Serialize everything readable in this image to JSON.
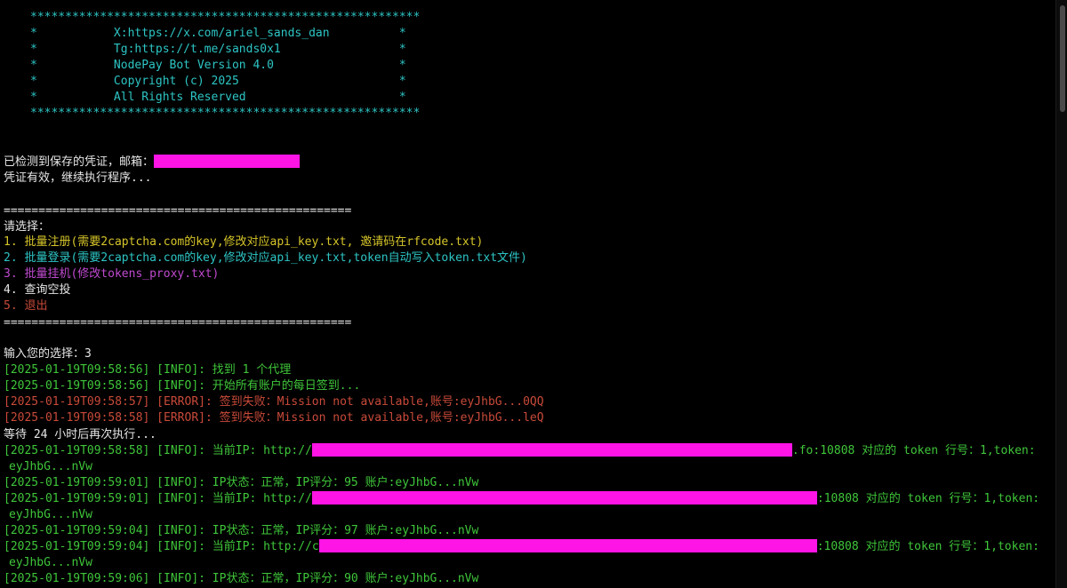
{
  "banner": {
    "border": "********************************************************",
    "lines": [
      "*           X:https://x.com/ariel_sands_dan          *",
      "*           Tg:https://t.me/sands0x1                 *",
      "*           NodePay Bot Version 4.0                  *",
      "*           Copyright (c) 2025                       *",
      "*           All Rights Reserved                      *"
    ]
  },
  "credentials": {
    "detected": "已检测到保存的凭证，邮箱：",
    "valid": "凭证有效，继续执行程序..."
  },
  "menu": {
    "divider": "==================================================",
    "prompt": "请选择：",
    "options": [
      "1. 批量注册(需要2captcha.com的key,修改对应api_key.txt, 邀请码在rfcode.txt)",
      "2. 批量登录(需要2captcha.com的key,修改对应api_key.txt,token自动写入token.txt文件)",
      "3. 批量挂机(修改tokens_proxy.txt)",
      "4. 查询空投",
      "5. 退出"
    ]
  },
  "input_prompt": "输入您的选择：3",
  "log": {
    "l1": "[2025-01-19T09:58:56] [INFO]: 找到 1 个代理",
    "l2": "[2025-01-19T09:58:56] [INFO]: 开始所有账户的每日签到...",
    "l3": "[2025-01-19T09:58:57] [ERROR]: 签到失败：Mission not available,账号:eyJhbG...0QQ",
    "l4": "[2025-01-19T09:58:58] [ERROR]: 签到失败：Mission not available,账号:eyJhbG...leQ",
    "wait": "等待 24 小时后再次执行...",
    "ip1_prefix": "[2025-01-19T09:58:58] [INFO]: 当前IP: http://",
    "ip1_suffix": ".fo:10808 对应的 token 行号：1,token:",
    "ip1_token": "eyJhbG...nVw",
    "status1": "[2025-01-19T09:59:01] [INFO]: IP状态：正常，IP评分：95 账户:eyJhbG...nVw",
    "ip2_prefix": "[2025-01-19T09:59:01] [INFO]: 当前IP: http://",
    "ip2_suffix": ":10808 对应的 token 行号：1,token:",
    "ip2_token": "eyJhbG...nVw",
    "status2": "[2025-01-19T09:59:04] [INFO]: IP状态：正常，IP评分：97 账户:eyJhbG...nVw",
    "ip3_prefix": "[2025-01-19T09:59:04] [INFO]: 当前IP: http://c",
    "ip3_suffix": ":10808 对应的 token 行号：1,token:",
    "ip3_token": "eyJhbG...nVw",
    "status3": "[2025-01-19T09:59:06] [INFO]: IP状态：正常，IP评分：90 账户:eyJhbG...nVw"
  },
  "colors": {
    "cyan": "#2ec4c4",
    "yellow": "#d6c52a",
    "magenta": "#c04ad0",
    "red": "#c94a3a",
    "green": "#3fc63a",
    "redaction": "#ff14e6"
  }
}
